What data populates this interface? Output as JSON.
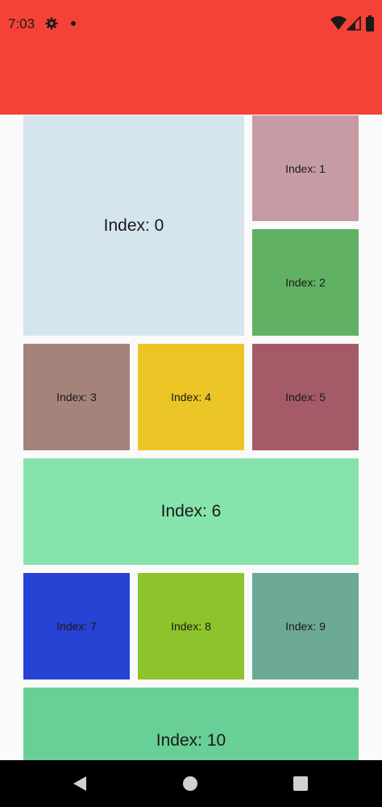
{
  "status_bar": {
    "time": "7:03",
    "icons": [
      "gear-icon",
      "notification-dot-icon",
      "wifi-icon",
      "signal-icon",
      "battery-icon"
    ]
  },
  "app_bar": {
    "color": "#f44336"
  },
  "grid": {
    "tiles": [
      {
        "label": "Index: 0",
        "color": "#d5e5ee"
      },
      {
        "label": "Index: 1",
        "color": "#c69ba4"
      },
      {
        "label": "Index: 2",
        "color": "#60b163"
      },
      {
        "label": "Index: 3",
        "color": "#a4837b"
      },
      {
        "label": "Index: 4",
        "color": "#ebc526"
      },
      {
        "label": "Index: 5",
        "color": "#a55a68"
      },
      {
        "label": "Index: 6",
        "color": "#86e3ac"
      },
      {
        "label": "Index: 7",
        "color": "#2643d4"
      },
      {
        "label": "Index: 8",
        "color": "#8dc42c"
      },
      {
        "label": "Index: 9",
        "color": "#6ca996"
      },
      {
        "label": "Index: 10",
        "color": "#68cf96"
      }
    ]
  },
  "nav_bar": {
    "buttons": [
      "back-icon",
      "home-icon",
      "recents-icon"
    ]
  }
}
